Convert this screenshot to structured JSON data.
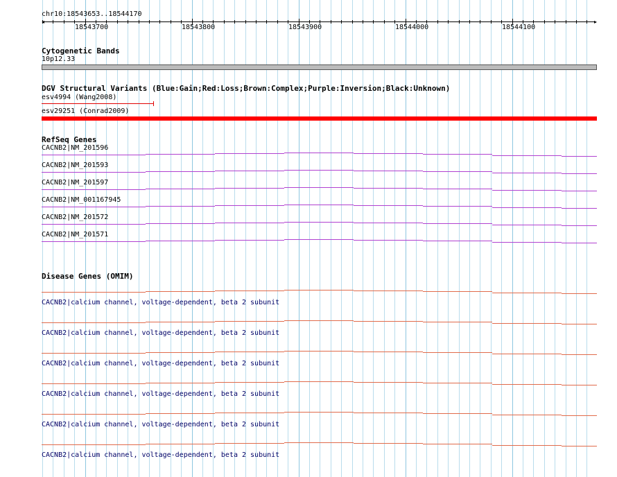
{
  "region_label": "chr10:18543653..18544170",
  "ruler": {
    "ticks": [
      "18543700",
      "18543800",
      "18543900",
      "18544000",
      "18544100"
    ]
  },
  "cytoband": {
    "title": "Cytogenetic Bands",
    "band": "10p12.33"
  },
  "dgv": {
    "title": "DGV Structural Variants (Blue:Gain;Red:Loss;Brown:Complex;Purple:Inversion;Black:Unknown)",
    "variants": [
      {
        "label": "esv4994 (Wang2008)",
        "color": "#e00000"
      },
      {
        "label": "esv29251 (Conrad2009)",
        "color": "#ff0000"
      }
    ]
  },
  "refseq": {
    "title": "RefSeq Genes",
    "color": "#b040d0",
    "genes": [
      "CACNB2|NM_201596",
      "CACNB2|NM_201593",
      "CACNB2|NM_201597",
      "CACNB2|NM_001167945",
      "CACNB2|NM_201572",
      "CACNB2|NM_201571"
    ]
  },
  "omim": {
    "title": "Disease Genes (OMIM)",
    "color": "#e06a4a",
    "label_color": "#000066",
    "entries": [
      "CACNB2|calcium channel, voltage-dependent, beta 2 subunit",
      "CACNB2|calcium channel, voltage-dependent, beta 2 subunit",
      "CACNB2|calcium channel, voltage-dependent, beta 2 subunit",
      "CACNB2|calcium channel, voltage-dependent, beta 2 subunit",
      "CACNB2|calcium channel, voltage-dependent, beta 2 subunit",
      "CACNB2|calcium channel, voltage-dependent, beta 2 subunit"
    ]
  }
}
